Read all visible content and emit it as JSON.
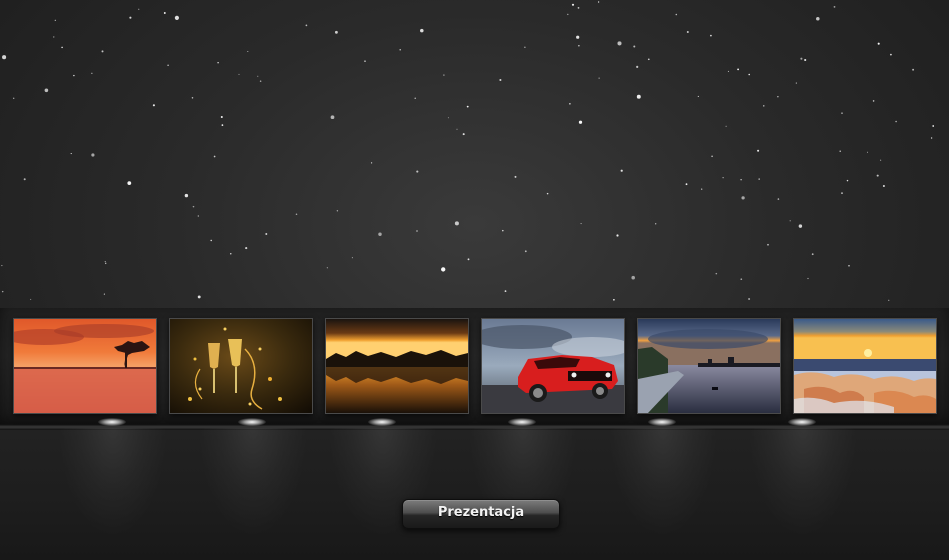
{
  "gallery": {
    "thumbnails": [
      {
        "name": "lake-sunset-tree"
      },
      {
        "name": "champagne-glasses"
      },
      {
        "name": "sunset-reflection-forest"
      },
      {
        "name": "red-mustang-car"
      },
      {
        "name": "river-city-dusk"
      },
      {
        "name": "winter-beach-sunset"
      }
    ]
  },
  "controls": {
    "present_label": "Prezentacja"
  },
  "colors": {
    "background": "#2a2a2a",
    "shelf": "#222222",
    "button_text": "#f2f2f2"
  }
}
